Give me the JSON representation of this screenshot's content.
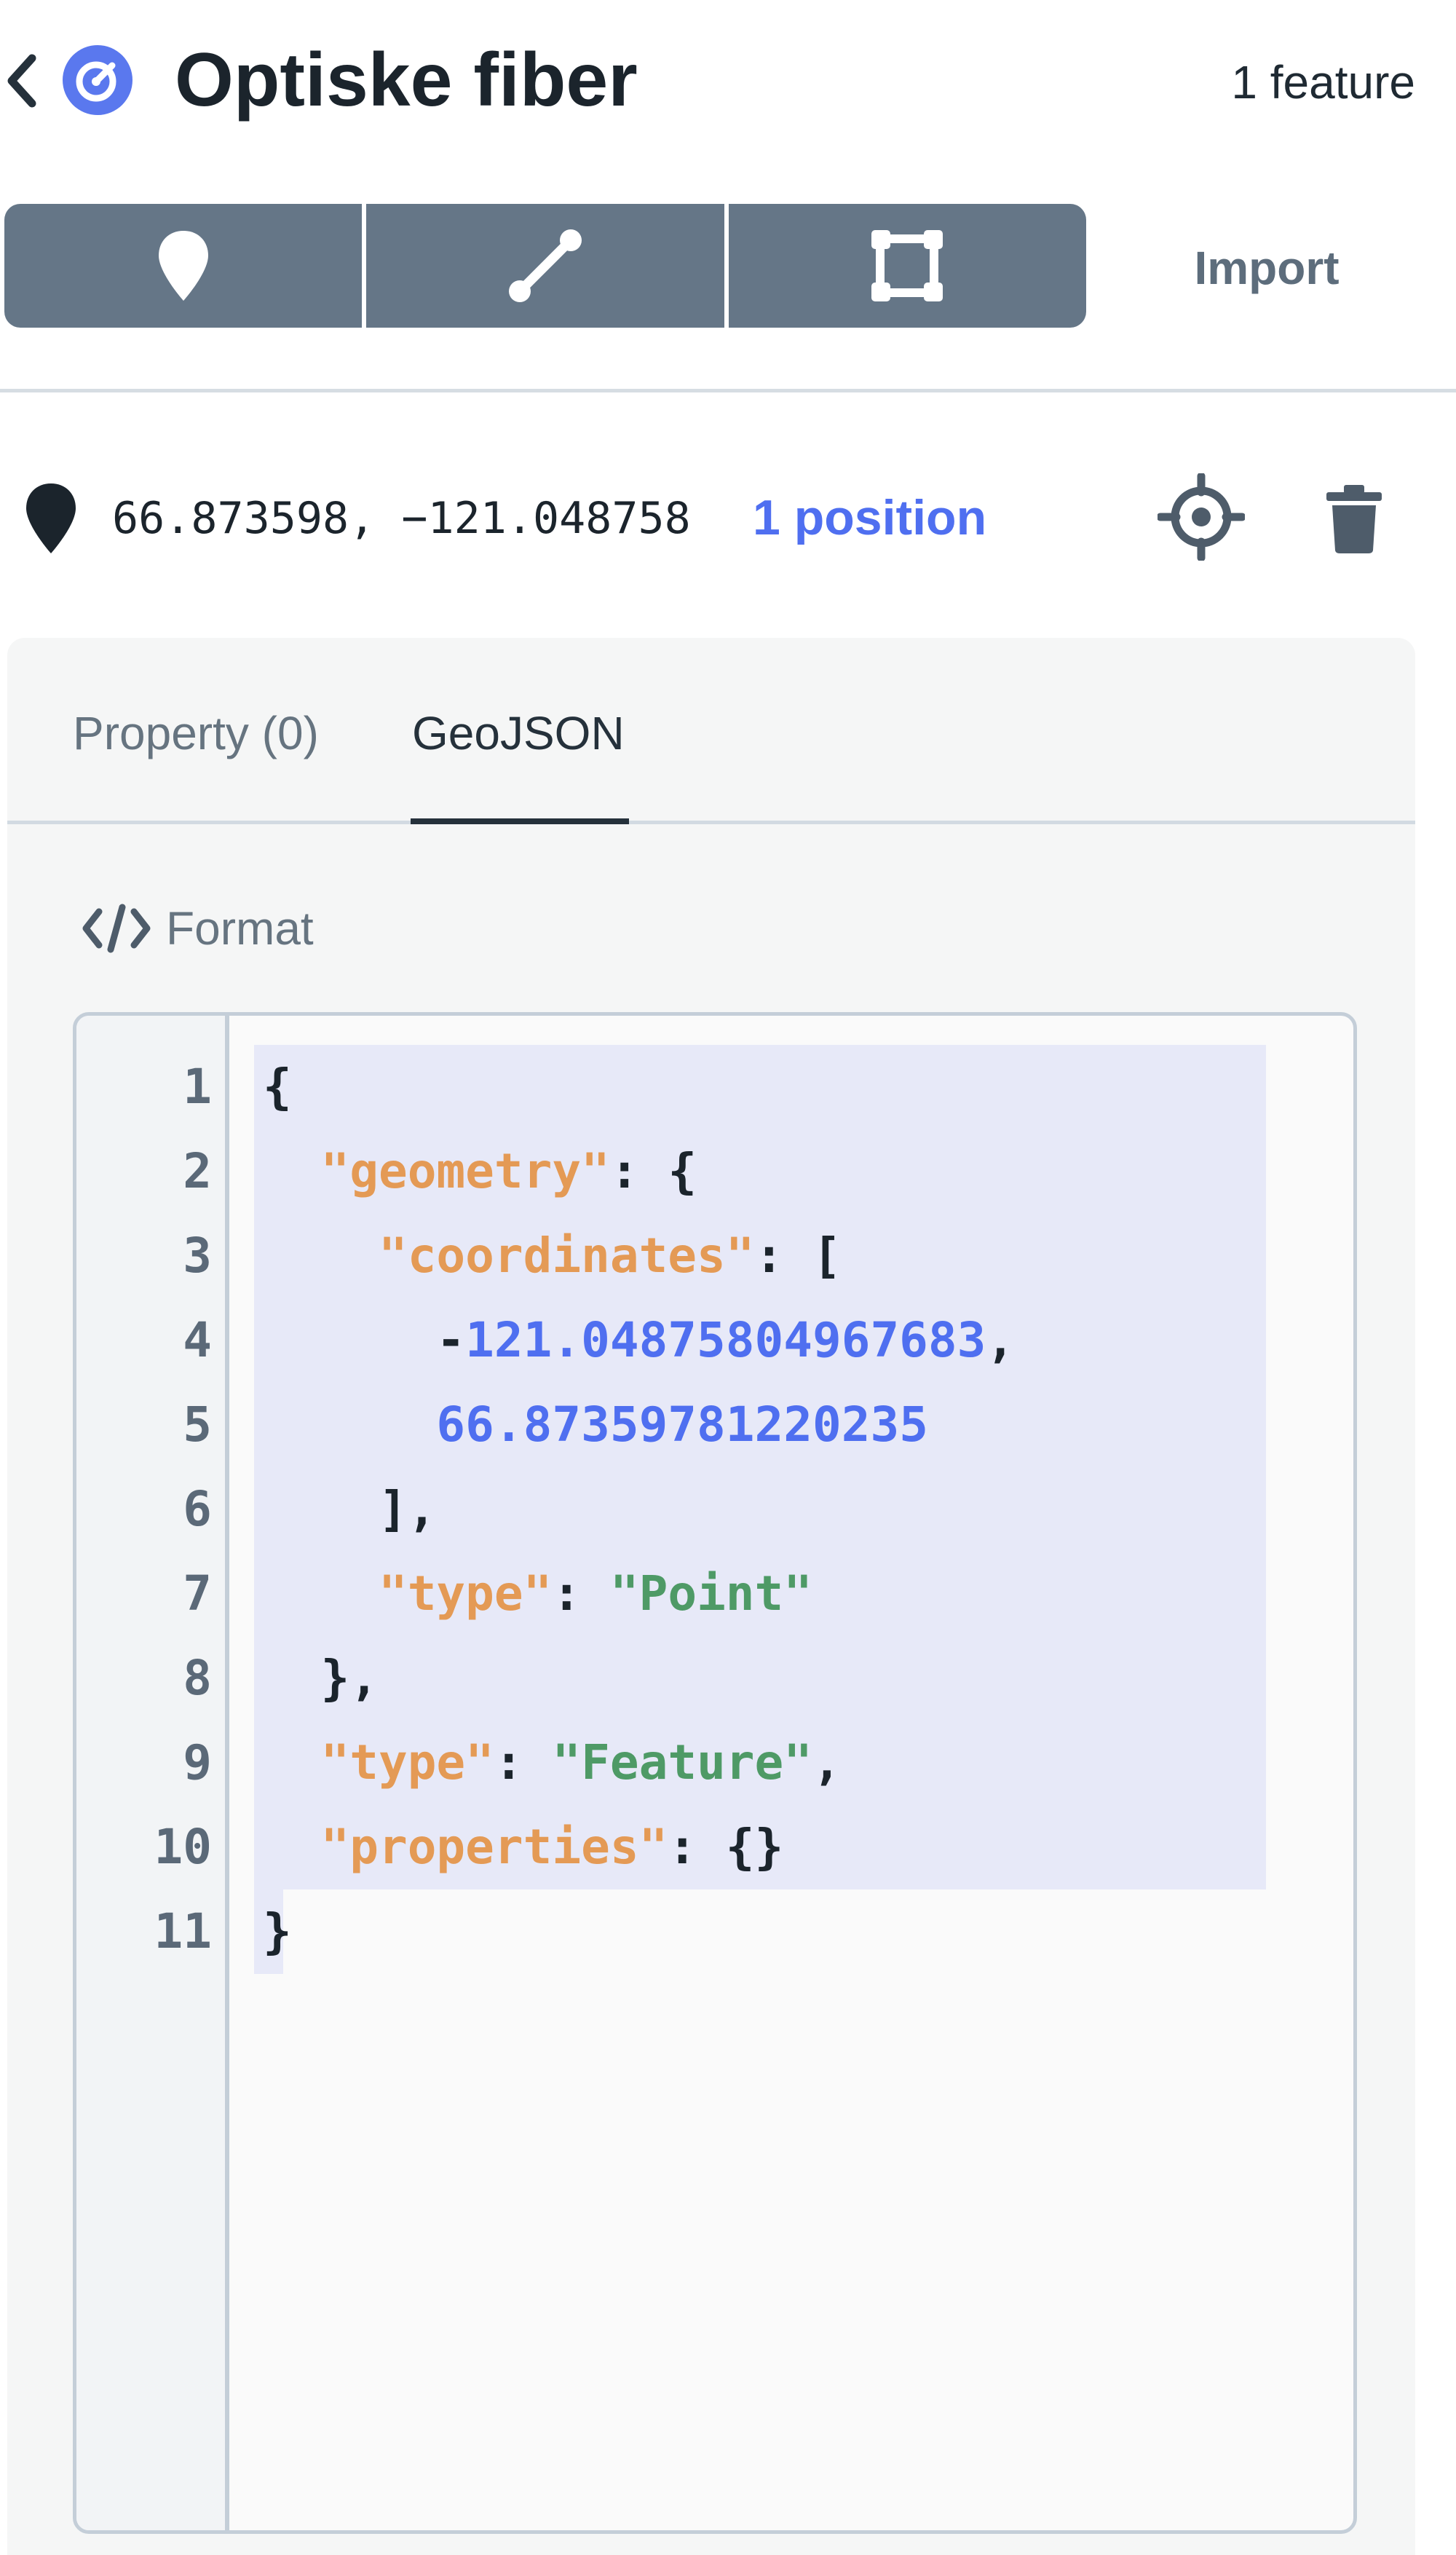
{
  "header": {
    "title": "Optiske fiber",
    "feature_count": "1 feature",
    "back_icon": "chevron-left-icon",
    "logo_icon": "app-logo-icon"
  },
  "toolbar": {
    "tools": [
      {
        "name": "point",
        "icon": "map-pin-icon"
      },
      {
        "name": "line",
        "icon": "line-segment-icon"
      },
      {
        "name": "polygon",
        "icon": "polygon-square-icon"
      }
    ],
    "import_label": "Import"
  },
  "feature": {
    "coords": "66.873598, −121.048758",
    "position_link": "1 position",
    "locate_icon": "locate-crosshair-icon",
    "delete_icon": "trash-icon"
  },
  "tabs": [
    {
      "label": "Property (0)",
      "active": false
    },
    {
      "label": "GeoJSON",
      "active": true
    }
  ],
  "format": {
    "label": "Format",
    "icon": "code-brackets-icon"
  },
  "editor": {
    "line_numbers": [
      "1",
      "2",
      "3",
      "4",
      "5",
      "6",
      "7",
      "8",
      "9",
      "10",
      "11"
    ],
    "lines": [
      "{",
      "  \"geometry\": {",
      "    \"coordinates\": [",
      "      -121.04875804967683,",
      "      66.87359781220235",
      "    ],",
      "    \"type\": \"Point\"",
      "  },",
      "  \"type\": \"Feature\",",
      "  \"properties\": {}",
      "}"
    ]
  },
  "colors": {
    "toolbar_bg": "#657687",
    "accent_blue": "#4f6ff0",
    "json_key": "#e49a55",
    "json_string": "#4e9a66",
    "json_number": "#4f6ff0",
    "selection": "#e7e9f8"
  }
}
